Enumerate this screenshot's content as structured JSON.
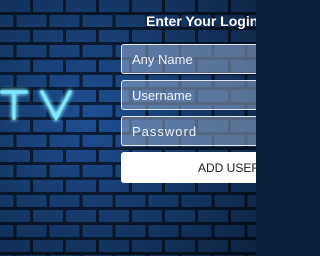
{
  "login_form": {
    "title": "Enter Your Login",
    "name_placeholder": "Any Name",
    "username_placeholder": "Username",
    "password_placeholder": "Password",
    "add_user_label": "ADD USER"
  },
  "logo": {
    "text": "TV"
  },
  "colors": {
    "background": "#0b1f3c",
    "brick": "#1e4f93",
    "mortar": "#0b1f3c",
    "neon": "#5fe0ff",
    "field_fill": "#96aacd",
    "button_fill": "#ffffff"
  }
}
